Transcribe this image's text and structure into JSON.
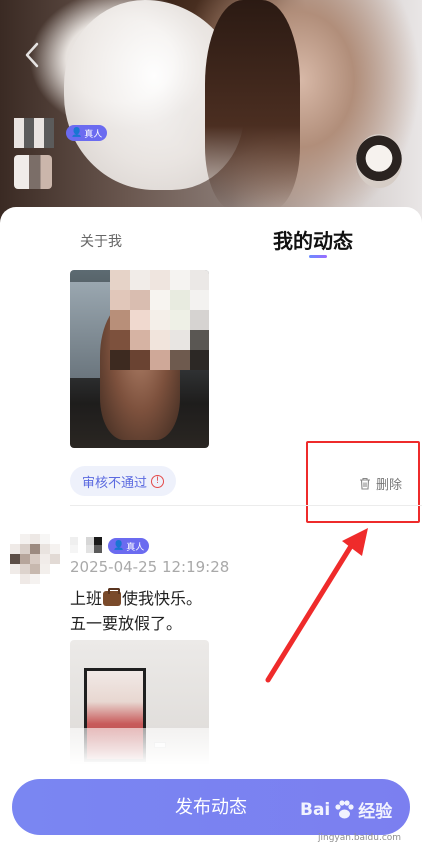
{
  "header": {
    "back_icon": "chevron-left-icon",
    "real_badge": "真人"
  },
  "tabs": [
    {
      "label": "关于我",
      "active": false
    },
    {
      "label": "我的动态",
      "active": true
    }
  ],
  "posts": [
    {
      "audit_status": "审核不通过",
      "delete_label": "删除"
    },
    {
      "real_badge": "真人",
      "timestamp": "2025-04-25 12:19:28",
      "text_line1_prefix": "上班",
      "text_line1_suffix": "使我快乐。",
      "text_line2": "五一要放假了。"
    }
  ],
  "footer": {
    "publish_label": "发布动态"
  },
  "watermark": {
    "brand": "Bai",
    "brand_tail": "经验",
    "url": "jingyan.baidu.com"
  },
  "colors": {
    "accent": "#7a86f2",
    "badge": "#6b6bf0",
    "highlight_box": "#ee2b2b"
  }
}
